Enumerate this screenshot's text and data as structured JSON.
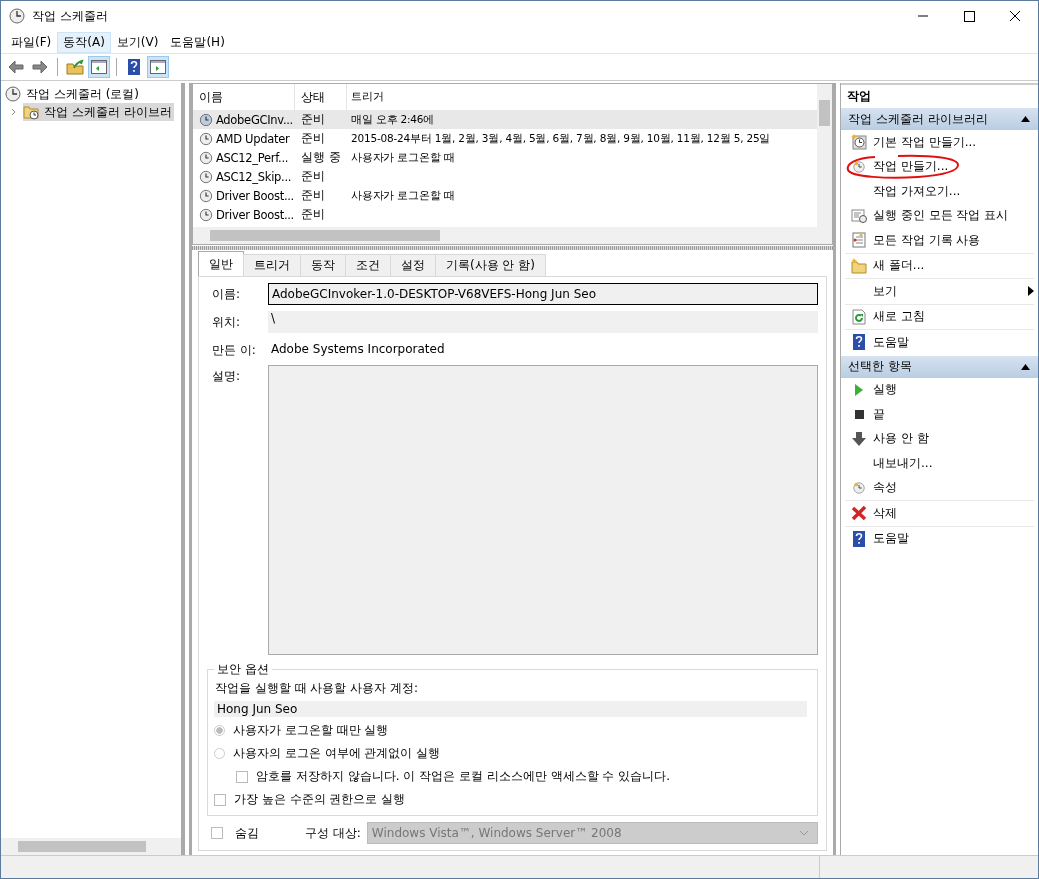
{
  "window": {
    "title": "작업 스케줄러"
  },
  "menu": [
    {
      "label": "파일(F)",
      "selected": false
    },
    {
      "label": "동작(A)",
      "selected": true
    },
    {
      "label": "보기(V)",
      "selected": false
    },
    {
      "label": "도움말(H)",
      "selected": false
    }
  ],
  "toolbar": [
    [
      {
        "kind": "back",
        "pressed": false
      },
      {
        "kind": "forward",
        "pressed": false
      }
    ],
    [
      {
        "kind": "folderup",
        "pressed": false
      },
      {
        "kind": "panelleft",
        "pressed": true
      }
    ],
    [
      {
        "kind": "help",
        "pressed": false
      },
      {
        "kind": "panelright",
        "pressed": true
      }
    ]
  ],
  "tree": [
    {
      "label": "작업 스케줄러 (로컬)",
      "selected": false,
      "children": [
        {
          "label": "작업 스케줄러 라이브러",
          "selected": true,
          "expanded": false
        }
      ]
    }
  ],
  "task_list": {
    "columns": [
      "이름",
      "상태",
      "트리거"
    ],
    "rows": [
      {
        "name": "AdobeGCInv...",
        "status": "준비",
        "trigger": "매일 오후 2:46에",
        "selected": true
      },
      {
        "name": "AMD Updater",
        "status": "준비",
        "trigger": "2015-08-24부터 1월, 2월, 3월, 4월, 5월, 6월, 7월, 8월, 9월, 10월, 11월, 12월 5, 25일",
        "selected": false
      },
      {
        "name": "ASC12_Perf...",
        "status": "실행 중",
        "trigger": "사용자가 로그온할 때",
        "selected": false
      },
      {
        "name": "ASC12_Skip...",
        "status": "준비",
        "trigger": "",
        "selected": false
      },
      {
        "name": "Driver Boost...",
        "status": "준비",
        "trigger": "사용자가 로그온할 때",
        "selected": false
      },
      {
        "name": "Driver Boost...",
        "status": "준비",
        "trigger": "",
        "selected": false
      }
    ]
  },
  "detail": {
    "tabs": [
      {
        "label": "일반",
        "selected": true
      },
      {
        "label": "트리거",
        "selected": false
      },
      {
        "label": "동작",
        "selected": false
      },
      {
        "label": "조건",
        "selected": false
      },
      {
        "label": "설정",
        "selected": false
      },
      {
        "label": "기록(사용 안 함)",
        "selected": false
      }
    ],
    "name": {
      "label": "이름:",
      "value": "AdobeGCInvoker-1.0-DESKTOP-V68VEFS-Hong Jun Seo"
    },
    "location": {
      "label": "위치:",
      "value": "\\"
    },
    "author": {
      "label": "만든 이:",
      "value": "Adobe Systems Incorporated"
    },
    "description": {
      "label": "설명:"
    },
    "security": {
      "title": "보안 옵션",
      "account_label": "작업을 실행할 때 사용할 사용자 계정:",
      "account": "Hong Jun Seo",
      "options": [
        {
          "kind": "radio",
          "label": "사용자가 로그온할 때만 실행",
          "selected": true
        },
        {
          "kind": "radio",
          "label": "사용자의 로그온 여부에 관계없이 실행",
          "selected": false,
          "children": [
            {
              "kind": "checkbox",
              "label": "암호를 저장하지 않습니다. 이 작업은 로컬 리소스에만 액세스할 수 있습니다.",
              "checked": false
            }
          ]
        },
        {
          "kind": "checkbox",
          "label": "가장 높은 수준의 권한으로 실행",
          "checked": false
        }
      ]
    },
    "hidden": {
      "label": "숨김",
      "checked": false
    },
    "configure": {
      "label": "구성 대상:",
      "value": "Windows Vista™, Windows Server™ 2008"
    }
  },
  "actions": {
    "title": "작업",
    "sections": [
      {
        "title": "작업 스케줄러 라이브러리",
        "expanded": true,
        "items": [
          {
            "label": "기본 작업 만들기...",
            "kind": "clockstar",
            "separator": false,
            "submenu": false,
            "highlighted": false
          },
          {
            "label": "작업 만들기...",
            "kind": "clock",
            "separator": false,
            "submenu": false,
            "highlighted": true
          },
          {
            "label": "작업 가져오기...",
            "kind": "plain",
            "separator": false,
            "submenu": false,
            "highlighted": false
          },
          {
            "label": "실행 중인 모든 작업 표시",
            "kind": "listclock",
            "separator": false,
            "submenu": false,
            "highlighted": false
          },
          {
            "label": "모든 작업 기록 사용",
            "kind": "log",
            "separator": true,
            "submenu": false,
            "highlighted": false
          },
          {
            "label": "새 폴더...",
            "kind": "folder",
            "separator": true,
            "submenu": false,
            "highlighted": false
          },
          {
            "label": "보기",
            "kind": "plain",
            "separator": true,
            "submenu": true,
            "highlighted": false
          },
          {
            "label": "새로 고침",
            "kind": "refresh",
            "separator": true,
            "submenu": false,
            "highlighted": false
          },
          {
            "label": "도움말",
            "kind": "help",
            "separator": false,
            "submenu": false,
            "highlighted": false
          }
        ]
      },
      {
        "title": "선택한 항목",
        "expanded": true,
        "items": [
          {
            "label": "실행",
            "kind": "play",
            "separator": false,
            "submenu": false,
            "highlighted": false
          },
          {
            "label": "끝",
            "kind": "stop",
            "separator": false,
            "submenu": false,
            "highlighted": false
          },
          {
            "label": "사용 안 함",
            "kind": "down",
            "separator": false,
            "submenu": false,
            "highlighted": false
          },
          {
            "label": "내보내기...",
            "kind": "plain",
            "separator": false,
            "submenu": false,
            "highlighted": false
          },
          {
            "label": "속성",
            "kind": "clock",
            "separator": true,
            "submenu": false,
            "highlighted": false
          },
          {
            "label": "삭제",
            "kind": "delete",
            "separator": true,
            "submenu": false,
            "highlighted": false
          },
          {
            "label": "도움말",
            "kind": "help",
            "separator": false,
            "submenu": false,
            "highlighted": false
          }
        ]
      }
    ]
  }
}
